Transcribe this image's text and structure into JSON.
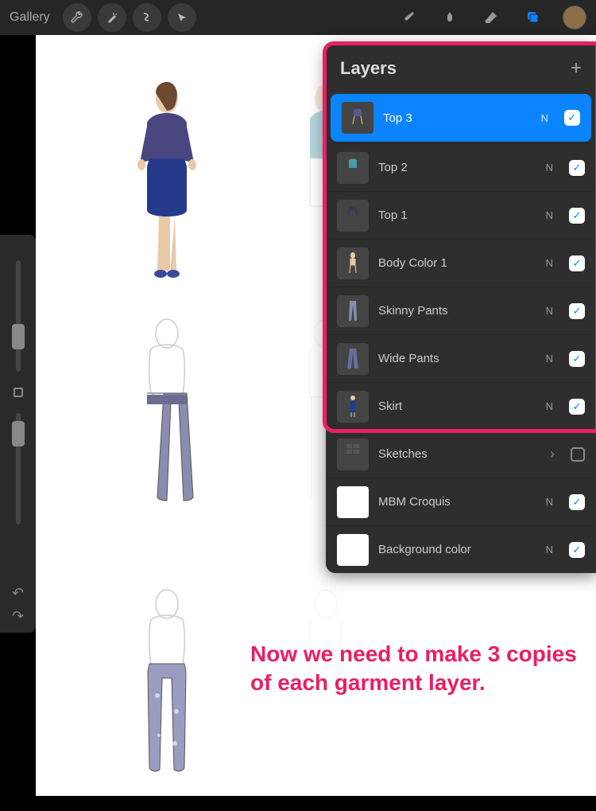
{
  "topbar": {
    "gallery": "Gallery"
  },
  "panel": {
    "title": "Layers"
  },
  "layers": [
    {
      "name": "Top 3",
      "blend": "N",
      "visible": true,
      "selected": true,
      "thumb": "top-purple"
    },
    {
      "name": "Top 2",
      "blend": "N",
      "visible": true,
      "selected": false,
      "thumb": "top-teal"
    },
    {
      "name": "Top 1",
      "blend": "N",
      "visible": true,
      "selected": false,
      "thumb": "top-dark"
    },
    {
      "name": "Body Color 1",
      "blend": "N",
      "visible": true,
      "selected": false,
      "thumb": "body"
    },
    {
      "name": "Skinny Pants",
      "blend": "N",
      "visible": true,
      "selected": false,
      "thumb": "pants-skinny"
    },
    {
      "name": "Wide Pants",
      "blend": "N",
      "visible": true,
      "selected": false,
      "thumb": "pants-wide"
    },
    {
      "name": "Skirt",
      "blend": "N",
      "visible": true,
      "selected": false,
      "thumb": "skirt"
    },
    {
      "name": "Sketches",
      "blend": "",
      "visible": false,
      "selected": false,
      "thumb": "group",
      "chevron": true
    },
    {
      "name": "MBM Croquis",
      "blend": "N",
      "visible": true,
      "selected": false,
      "thumb": "white"
    },
    {
      "name": "Background color",
      "blend": "N",
      "visible": true,
      "selected": false,
      "thumb": "white"
    }
  ],
  "annotation": {
    "text": "Now we need to make 3 copies of each garment layer."
  }
}
